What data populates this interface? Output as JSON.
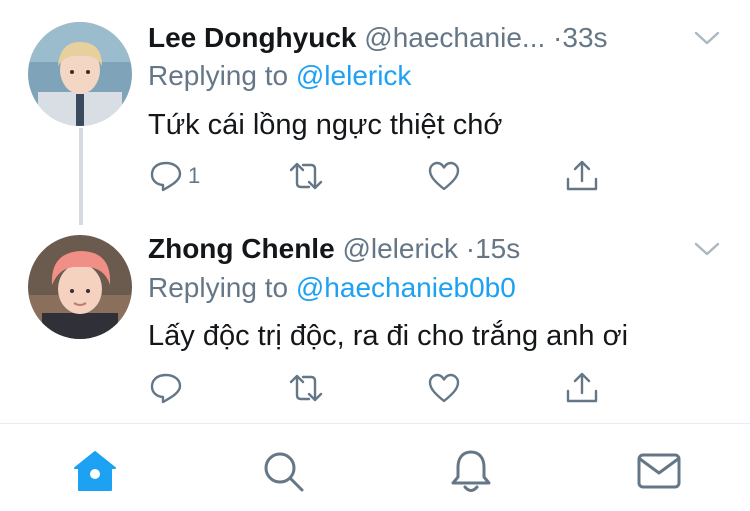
{
  "tweets": [
    {
      "name": "Lee Donghyuck",
      "handle": "@haechanie...",
      "dot": "·",
      "time": "33s",
      "replying_prefix": "Replying to",
      "replying_to": "@lelerick",
      "text": "Tứk cái lồng ngực thiệt chớ",
      "reply_count": "1"
    },
    {
      "name": "Zhong Chenle",
      "handle": "@lelerick",
      "dot": "·",
      "time": "15s",
      "replying_prefix": "Replying to",
      "replying_to": "@haechanieb0b0",
      "text": "Lấy độc trị độc, ra đi cho trắng anh ơi",
      "reply_count": ""
    }
  ],
  "icons": {
    "reply": "reply-icon",
    "retweet": "retweet-icon",
    "like": "like-icon",
    "share": "share-icon",
    "caret": "chevron-down-icon",
    "tabs": [
      "home-icon",
      "search-icon",
      "notifications-icon",
      "messages-icon"
    ]
  },
  "colors": {
    "accent": "#1da1f2",
    "secondary_text": "#657786",
    "icon_gray": "#657786",
    "thread_line": "#d4dae0",
    "home_active": "#1da1f2"
  }
}
